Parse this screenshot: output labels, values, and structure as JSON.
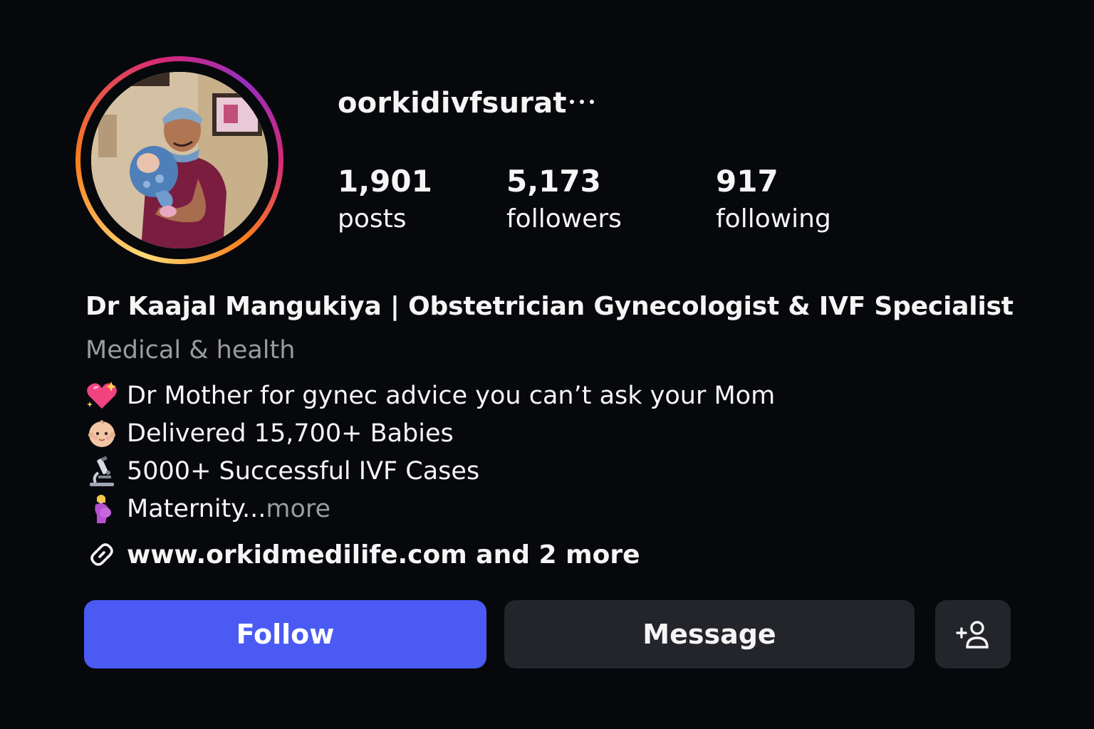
{
  "profile": {
    "username": "oorkidivfsurat",
    "more_icon": "more-horizontal-icon",
    "stats": {
      "posts": {
        "value": "1,901",
        "label": "posts"
      },
      "followers": {
        "value": "5,173",
        "label": "followers"
      },
      "following": {
        "value": "917",
        "label": "following"
      }
    },
    "display_name": "Dr Kaajal Mangukiya | Obstetrician Gynecologist & IVF Specialist",
    "category": "Medical & health",
    "bio": [
      {
        "icon": "sparkling-heart-icon",
        "text": "Dr Mother for gynec advice you can’t ask your Mom"
      },
      {
        "icon": "baby-icon",
        "text": "Delivered 15,700+ Babies"
      },
      {
        "icon": "microscope-icon",
        "text": "5000+ Successful IVF Cases"
      },
      {
        "icon": "pregnant-woman-icon",
        "text": "Maternity...",
        "more": " more"
      }
    ],
    "link": {
      "icon": "link-icon",
      "text": "www.orkidmedilife.com and 2 more"
    }
  },
  "actions": {
    "follow_label": "Follow",
    "message_label": "Message",
    "add_user_icon": "add-user-icon"
  },
  "colors": {
    "background": "#07080c",
    "follow": "#4a5af3",
    "secondary_button": "#23252b",
    "muted_text": "#9a9ba0"
  }
}
